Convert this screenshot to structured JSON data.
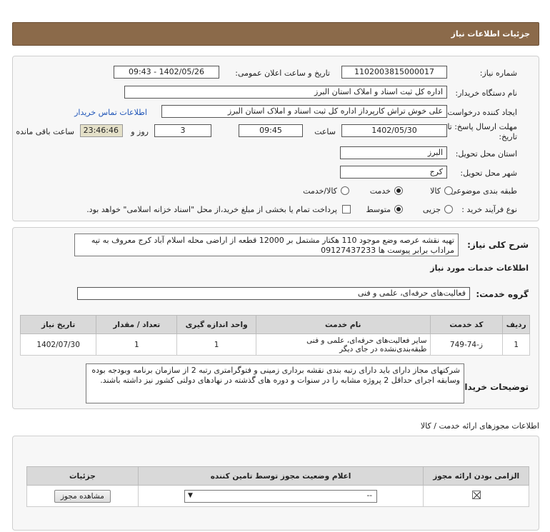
{
  "header": {
    "title": "جزئیات اطلاعات نیاز"
  },
  "fields": {
    "need_number_label": "شماره نیاز:",
    "need_number": "1102003815000017",
    "announce_label": "تاریخ و ساعت اعلان عمومی:",
    "announce_value": "1402/05/26 - 09:43",
    "buyer_org_label": "نام دستگاه خریدار:",
    "buyer_org": "اداره کل ثبت اسناد و املاک استان البرز",
    "creator_label": "ایجاد کننده درخواست:",
    "creator": "علی خوش تراش کارپرداز اداره کل ثبت اسناد و املاک استان البرز",
    "contact_link": "اطلاعات تماس خریدار",
    "deadline_label_1": "مهلت ارسال پاسخ: تا",
    "deadline_label_2": "تاریخ:",
    "deadline_date": "1402/05/30",
    "time_label": "ساعت",
    "deadline_time": "09:45",
    "days_value": "3",
    "days_label": "روز و",
    "remaining_time": "23:46:46",
    "remaining_label": "ساعت باقی مانده",
    "province_label": "استان محل تحویل:",
    "province": "البرز",
    "city_label": "شهر محل تحویل:",
    "city": "کرج",
    "category_label": "طبقه بندی موضوعی:",
    "category_options": [
      "کالا",
      "خدمت",
      "کالا/خدمت"
    ],
    "category_selected": "خدمت",
    "process_label": "نوع فرآیند خرید :",
    "process_options": [
      "جزیی",
      "متوسط"
    ],
    "process_selected": "متوسط",
    "payment_note": "پرداخت تمام یا بخشی از مبلغ خرید،از محل \"اسناد خزانه اسلامی\" خواهد بود."
  },
  "summary": {
    "label": "شرح کلی نیاز:",
    "text": "تهیه نقشه عرصه وضع موجود 110 هکتار مشتمل بر 12000 قطعه از اراضی محله اسلام آباد کرج معروف به تپه مراداب برابر پیوست ها 09127437233"
  },
  "services": {
    "section_title": "اطلاعات خدمات مورد نیاز",
    "group_label": "گروه خدمت:",
    "group_value": "فعالیت‌های حرفه‌ای، علمی و فنی",
    "columns": [
      "ردیف",
      "کد خدمت",
      "نام خدمت",
      "واحد اندازه گیری",
      "تعداد / مقدار",
      "تاریخ نیاز"
    ],
    "rows": [
      {
        "row": "1",
        "code": "ز-74-749",
        "name": "سایر فعالیت‌های حرفه‌ای، علمی و فنی طبقه‌بندی‌نشده در جای دیگر",
        "unit": "1",
        "qty": "1",
        "date": "1402/07/30"
      }
    ]
  },
  "buyer_notes": {
    "label": "توضیحات خریدار:",
    "text": "شرکتهای مجاز دارای باید دارای رتبه بندی نقشه برداری زمینی و فتوگرامتری رتبه 2 از سازمان برنامه وبودجه بوده وسابقه اجرای حداقل 2 پروژه مشابه را در سنوات و دوره های گذشته در نهادهای دولتی کشور نیز داشته باشند."
  },
  "permits": {
    "title": "اطلاعات مجوزهای ارائه خدمت / کالا",
    "columns": [
      "الزامی بودن ارائه مجوز",
      "اعلام وضعیت مجوز توسط تامین کننده",
      "جزئیات"
    ],
    "status_value": "--",
    "view_button": "مشاهده مجوز"
  }
}
